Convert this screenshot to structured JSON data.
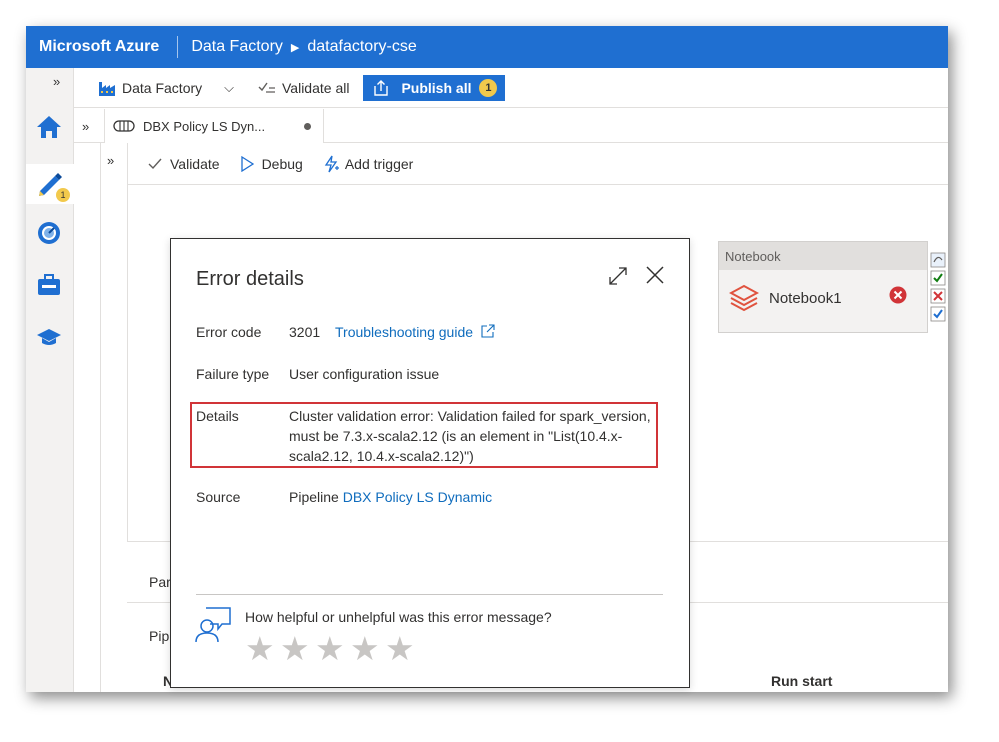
{
  "topbar": {
    "brand": "Microsoft Azure",
    "breadcrumb_1": "Data Factory",
    "breadcrumb_sep": "▶",
    "breadcrumb_2": "datafactory-cse"
  },
  "rail": {
    "expand": "»",
    "author_badge": "1",
    "icons": [
      "home-icon",
      "pencil-icon",
      "monitor-icon",
      "toolbox-icon",
      "learn-icon"
    ]
  },
  "toolbar": {
    "factory_label": "Data Factory",
    "dropdown": "⌵",
    "validate_all": "Validate all",
    "publish_all": "Publish all",
    "publish_count": "1"
  },
  "tabs": {
    "expand": "»",
    "pipeline_tab": "DBX Policy LS Dyn..."
  },
  "commands": {
    "expand": "»",
    "validate": "Validate",
    "debug": "Debug",
    "add_trigger": "Add trigger"
  },
  "activity": {
    "type": "Notebook",
    "name": "Notebook1"
  },
  "bottom_panel": {
    "tab1": "Par",
    "tab2": "Pip",
    "col_n": "N",
    "col_run_start": "Run start"
  },
  "dialog": {
    "title": "Error details",
    "error_code_label": "Error code",
    "error_code": "3201",
    "troubleshooting_link": "Troubleshooting guide",
    "failure_type_label": "Failure type",
    "failure_type": "User configuration issue",
    "details_label": "Details",
    "details_line1": "Cluster validation error: Validation failed for spark_version,",
    "details_line2": "must be 7.3.x-scala2.12 (is an element in \"List(10.4.x-",
    "details_line3": "scala2.12, 10.4.x-scala2.12)\")",
    "source_label": "Source",
    "source_prefix": "Pipeline",
    "source_link": "DBX Policy LS Dynamic",
    "feedback_question": "How helpful or unhelpful was this error message?",
    "rating": 0,
    "rating_max": 5
  },
  "colors": {
    "azure_blue": "#1f6fd1",
    "link": "#0f6cbd",
    "highlight_border": "#d13438",
    "error_red": "#d13438"
  }
}
